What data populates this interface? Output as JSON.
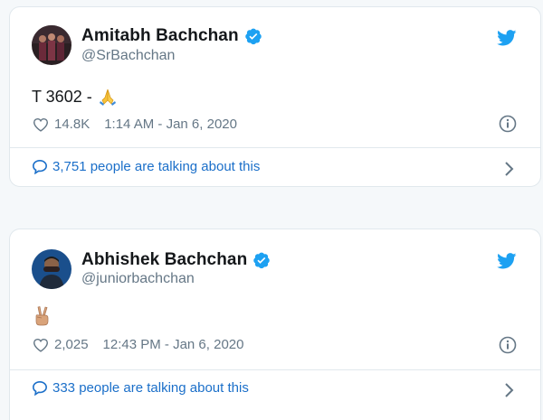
{
  "colors": {
    "background": "#f5f8fa",
    "card": "#ffffff",
    "border": "#e1e8ed",
    "verified": "#1da1f2",
    "twitter": "#1da1f2",
    "link": "#1b6fc9",
    "muted": "#657786"
  },
  "tweets": [
    {
      "author": "Amitabh Bachchan",
      "handle": "@SrBachchan",
      "text": "T 3602 -",
      "emoji": "folded-hands",
      "likes": "14.8K",
      "timestamp": "1:14 AM - Jan 6, 2020",
      "talking": "3,751 people are talking about this"
    },
    {
      "author": "Abhishek Bachchan",
      "handle": "@juniorbachchan",
      "text": "",
      "emoji": "victory-hand",
      "likes": "2,025",
      "timestamp": "12:43 PM - Jan 6, 2020",
      "talking": "333 people are talking about this"
    }
  ]
}
